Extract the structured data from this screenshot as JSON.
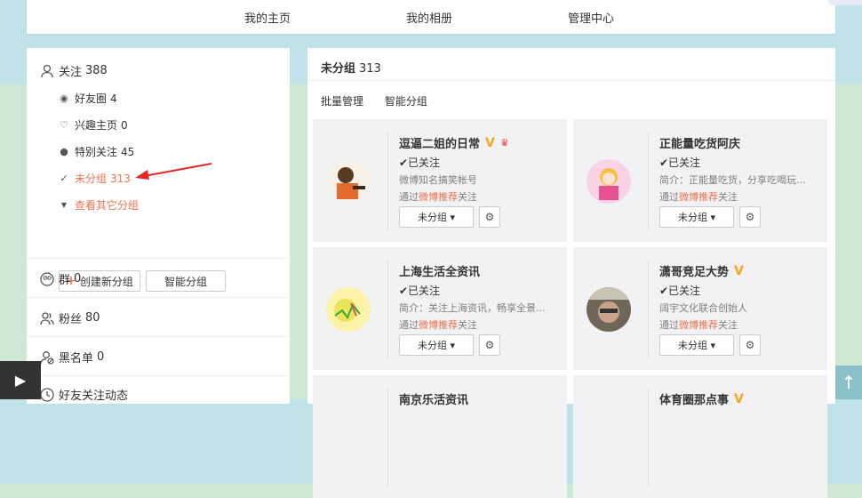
{
  "nav": {
    "items": [
      "我的主页",
      "我的相册",
      "管理中心"
    ]
  },
  "sidebar": {
    "follow": {
      "label": "关注",
      "count": "388"
    },
    "groups": [
      {
        "icon": "circle-target-icon",
        "label": "好友圈",
        "count": "4"
      },
      {
        "icon": "heart-outline-icon",
        "label": "兴趣主页",
        "count": "0"
      },
      {
        "icon": "dot-icon",
        "label": "特别关注",
        "count": "45"
      },
      {
        "icon": "check-icon",
        "label": "未分组",
        "count": "313"
      }
    ],
    "more_groups": "查看其它分组",
    "create_group": "创建新分组",
    "smart_group": "智能分组",
    "sections": [
      {
        "icon": "group-icon",
        "label": "群",
        "count": "0"
      },
      {
        "icon": "fans-icon",
        "label": "粉丝",
        "count": "80"
      },
      {
        "icon": "blacklist-icon",
        "label": "黑名单",
        "count": "0"
      },
      {
        "icon": "friends-activity-icon",
        "label": "好友关注动态",
        "count": ""
      }
    ]
  },
  "main": {
    "title": "未分组",
    "count": "313",
    "tabs": [
      "批量管理",
      "智能分组"
    ],
    "cards": [
      {
        "name": "逗逼二姐的日常",
        "verified": "V",
        "status": "✔已关注",
        "desc": "微博知名搞笑帐号",
        "via_prefix": "通过",
        "via_link": "微博推荐",
        "via_suffix": "关注",
        "group": "未分组 ▾"
      },
      {
        "name": "正能量吃货阿庆",
        "verified": "",
        "status": "✔已关注",
        "desc": "简介：正能量吃货，分享吃喝玩...",
        "via_prefix": "通过",
        "via_link": "微博推荐",
        "via_suffix": "关注",
        "group": "未分组 ▾"
      },
      {
        "name": "上海生活全资讯",
        "verified": "",
        "status": "✔已关注",
        "desc": "简介：关注上海资讯，畅享全景...",
        "via_prefix": "通过",
        "via_link": "微博推荐",
        "via_suffix": "关注",
        "group": "未分组 ▾"
      },
      {
        "name": "潇哥竞足大势",
        "verified": "V",
        "status": "✔已关注",
        "desc": "阔宇文化联合创始人",
        "via_prefix": "通过",
        "via_link": "微博推荐",
        "via_suffix": "关注",
        "group": "未分组 ▾"
      },
      {
        "name": "南京乐活资讯",
        "verified": "",
        "status": "",
        "desc": "",
        "via_prefix": "",
        "via_link": "",
        "via_suffix": "",
        "group": ""
      },
      {
        "name": "体育圈那点事",
        "verified": "V",
        "status": "",
        "desc": "",
        "via_prefix": "",
        "via_link": "",
        "via_suffix": "",
        "group": ""
      }
    ]
  },
  "colors": {
    "accent": "#eb7350",
    "verified": "#f5a623",
    "arrow": "#e02a2a"
  }
}
